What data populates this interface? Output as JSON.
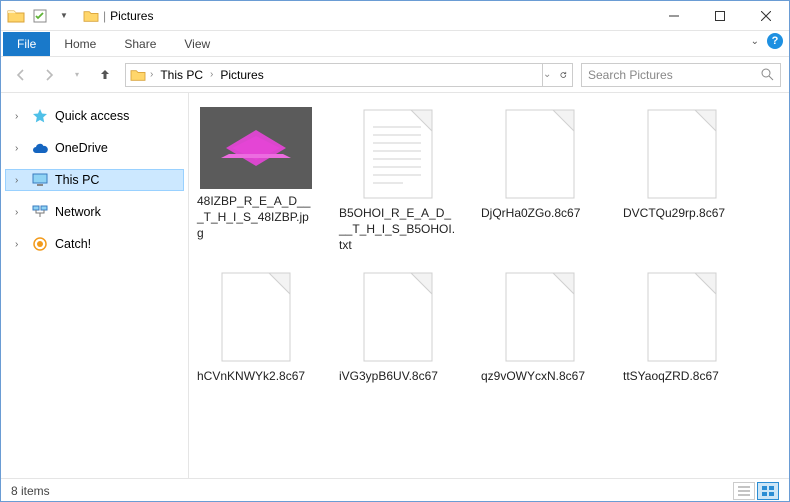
{
  "window": {
    "title": "Pictures"
  },
  "ribbon": {
    "file": "File",
    "home": "Home",
    "share": "Share",
    "view": "View"
  },
  "nav": {
    "quick_access": "Quick access",
    "onedrive": "OneDrive",
    "this_pc": "This PC",
    "network": "Network",
    "catch": "Catch!"
  },
  "breadcrumb": {
    "this_pc": "This PC",
    "pictures": "Pictures"
  },
  "search": {
    "placeholder": "Search Pictures"
  },
  "files": [
    {
      "name": "48IZBP_R_E_A_D___T_H_I_S_48IZBP.jpg",
      "type": "image"
    },
    {
      "name": "B5OHOI_R_E_A_D___T_H_I_S_B5OHOI.txt",
      "type": "text"
    },
    {
      "name": "DjQrHa0ZGo.8c67",
      "type": "blank"
    },
    {
      "name": "DVCTQu29rp.8c67",
      "type": "blank"
    },
    {
      "name": "hCVnKNWYk2.8c67",
      "type": "blank"
    },
    {
      "name": "iVG3ypB6UV.8c67",
      "type": "blank"
    },
    {
      "name": "qz9vOWYcxN.8c67",
      "type": "blank"
    },
    {
      "name": "ttSYaoqZRD.8c67",
      "type": "blank"
    }
  ],
  "status": {
    "count": "8 items"
  }
}
